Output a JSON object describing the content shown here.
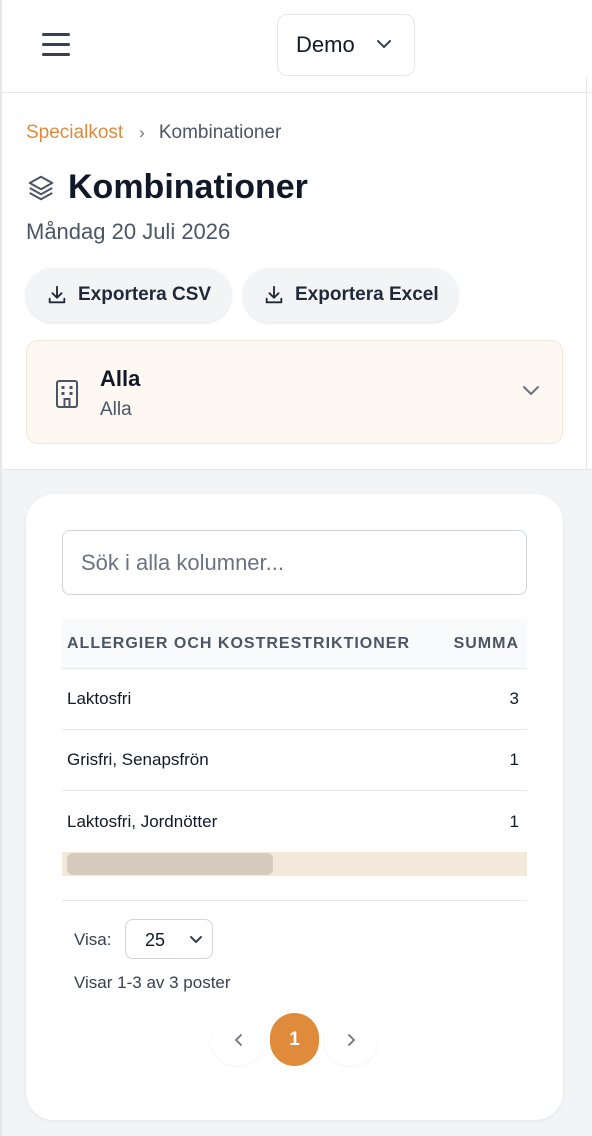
{
  "topbar": {
    "organization_selected": "Demo"
  },
  "breadcrumb": {
    "parent": "Specialkost",
    "separator": "›",
    "current": "Kombinationer"
  },
  "page": {
    "title": "Kombinationer",
    "date": "Måndag 20 Juli 2026"
  },
  "actions": {
    "export_csv_label": "Exportera CSV",
    "export_excel_label": "Exportera Excel"
  },
  "unit_selector": {
    "title": "Alla",
    "subtitle": "Alla"
  },
  "table": {
    "search_placeholder": "Sök i alla kolumner...",
    "columns": [
      "ALLERGIER OCH KOSTRESTRIKTIONER",
      "SUMMA"
    ],
    "rows": [
      {
        "name": "Laktosfri",
        "sum": "3"
      },
      {
        "name": "Grisfri, Senapsfrön",
        "sum": "1"
      },
      {
        "name": "Laktosfri, Jordnötter",
        "sum": "1"
      }
    ]
  },
  "footer": {
    "page_size_label": "Visa:",
    "page_size_value": "25",
    "showing_text": "Visar 1-3 av 3 poster",
    "current_page": "1",
    "prev_symbol": "‹",
    "next_symbol": "›"
  },
  "colors": {
    "accent": "#e08a3c",
    "unit_selector_bg": "#fdf8f1",
    "scrollbar_track": "#f3e9d9",
    "scrollbar_thumb": "#d6ccbd"
  },
  "icons": {
    "menu": "hamburger-icon",
    "org_dropdown": "chevron-down-icon",
    "title": "layers-icon",
    "export": "download-icon",
    "unit": "building-icon"
  }
}
